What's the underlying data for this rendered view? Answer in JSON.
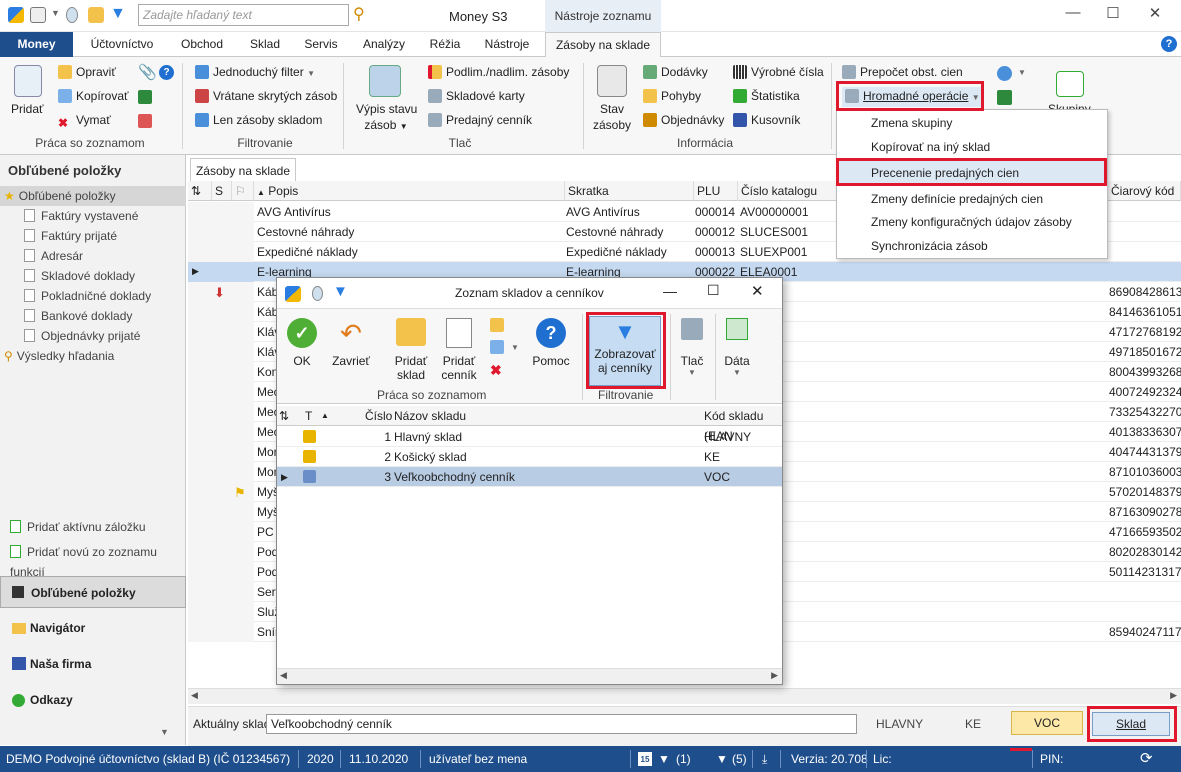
{
  "title_bar": {
    "app_title": "Money S3",
    "context_tab": "Nástroje zoznamu",
    "search_placeholder": "Zadajte hľadaný text"
  },
  "menu": {
    "items": [
      "Money",
      "Účtovníctvo",
      "Obchod",
      "Sklad",
      "Servis",
      "Analýzy",
      "Réžia",
      "Nástroje",
      "Zásoby na sklade"
    ],
    "active": "Zásoby na sklade"
  },
  "ribbon": {
    "praca": {
      "pridat": "Pridať",
      "opravit": "Opraviť",
      "kopirovat": "Kopírovať",
      "vymazat": "Vymať",
      "group": "Práca so zoznamom"
    },
    "filtrovanie": {
      "jednoduchy": "Jednoduchý filter",
      "vratane": "Vrátane skrytých zásob",
      "len": "Len zásoby skladom",
      "group": "Filtrovanie"
    },
    "tlac": {
      "vypis1": "Výpis stavu",
      "vypis2": "zásob",
      "podlim": "Podlim./nadlim. zásoby",
      "karty": "Skladové karty",
      "cennik": "Predajný cenník",
      "group": "Tlač"
    },
    "informacie": {
      "stav1": "Stav",
      "stav2": "zásoby",
      "dodavky": "Dodávky",
      "pohyby": "Pohyby",
      "objednavky": "Objednávky",
      "vyrobne": "Výrobné čísla",
      "statistika": "Štatistika",
      "kusovnik": "Kusovník",
      "group": "Informácia"
    },
    "extra": {
      "prepocet": "Prepočet obst. cien",
      "hromadne": "Hromadné operácie",
      "skupiny": "Skupiny"
    }
  },
  "dropdown": {
    "items": [
      "Zmena skupiny",
      "Kopírovať na iný sklad",
      "Precenenie predajných cien",
      "Zmeny definície predajných cien",
      "Zmeny konfiguračných údajov zásoby",
      "Synchronizácia zásob"
    ],
    "highlighted": "Precenenie predajných cien"
  },
  "sidebar": {
    "title": "Obľúbené položky",
    "root": "Obľúbené položky",
    "items": [
      "Faktúry vystavené",
      "Faktúry prijaté",
      "Adresár",
      "Skladové doklady",
      "Pokladničné doklady",
      "Bankové doklady",
      "Objednávky prijaté"
    ],
    "search_results": "Výsledky hľadania",
    "add_tab": "Pridať aktívnu záložku",
    "add_new": "Pridať novú zo zoznamu funkcií",
    "buttons": [
      "Obľúbené položky",
      "Navigátor",
      "Naša firma",
      "Odkazy"
    ]
  },
  "doc_tab": "Zásoby na sklade",
  "grid": {
    "headers": {
      "s": "S",
      "popis": "Popis",
      "skratka": "Skratka",
      "plu": "PLU",
      "katalog": "Číslo katalogu",
      "ciarovy": "Čiarový kód"
    },
    "rows": [
      {
        "popis": "AVG Antivírus",
        "skratka": "AVG Antivírus",
        "plu": "000014",
        "katalog": "AV00000001",
        "ciarovy": ""
      },
      {
        "popis": "Cestovné náhrady",
        "skratka": "Cestovné náhrady",
        "plu": "000012",
        "katalog": "SLUCES001",
        "ciarovy": ""
      },
      {
        "popis": "Expedičné náklady",
        "skratka": "Expedičné náklady",
        "plu": "000013",
        "katalog": "SLUEXP001",
        "ciarovy": ""
      },
      {
        "popis": "E-learning",
        "skratka": "E-learning",
        "plu": "000022",
        "katalog": "ELEA0001",
        "ciarovy": ""
      },
      {
        "popis": "Kábe",
        "skratka": "",
        "plu": "",
        "katalog": "001",
        "ciarovy": "86908428613"
      },
      {
        "popis": "Kábe",
        "skratka": "",
        "plu": "",
        "katalog": "001",
        "ciarovy": "84146361051"
      },
      {
        "popis": "Kláv",
        "skratka": "",
        "plu": "",
        "katalog": "001",
        "ciarovy": "47172768192"
      },
      {
        "popis": "Kláv",
        "skratka": "",
        "plu": "",
        "katalog": "001",
        "ciarovy": "49718501672"
      },
      {
        "popis": "Kon",
        "skratka": "",
        "plu": "",
        "katalog": "",
        "ciarovy": "80043993268"
      },
      {
        "popis": "Mec",
        "skratka": "",
        "plu": "",
        "katalog": "001",
        "ciarovy": "40072492324"
      },
      {
        "popis": "Mec",
        "skratka": "",
        "plu": "",
        "katalog": "001",
        "ciarovy": "73325432270"
      },
      {
        "popis": "Mec",
        "skratka": "",
        "plu": "",
        "katalog": "001",
        "ciarovy": "40138336307"
      },
      {
        "popis": "Mon",
        "skratka": "",
        "plu": "",
        "katalog": "001",
        "ciarovy": "40474431379"
      },
      {
        "popis": "Mon",
        "skratka": "",
        "plu": "",
        "katalog": "001",
        "ciarovy": "87101036003"
      },
      {
        "popis": "Myš",
        "skratka": "",
        "plu": "",
        "katalog": "001",
        "ciarovy": "57020148379"
      },
      {
        "popis": "Myš",
        "skratka": "",
        "plu": "",
        "katalog": "001",
        "ciarovy": "87163090278"
      },
      {
        "popis": "PC z",
        "skratka": "",
        "plu": "",
        "katalog": "001",
        "ciarovy": "47166593502"
      },
      {
        "popis": "Podl",
        "skratka": "",
        "plu": "",
        "katalog": "001",
        "ciarovy": "80202830142"
      },
      {
        "popis": "Podl",
        "skratka": "",
        "plu": "",
        "katalog": "001",
        "ciarovy": "50114231317"
      },
      {
        "popis": "Serv",
        "skratka": "",
        "plu": "",
        "katalog": "001",
        "ciarovy": ""
      },
      {
        "popis": "Služ",
        "skratka": "",
        "plu": "",
        "katalog": "001",
        "ciarovy": ""
      },
      {
        "popis": "Snín",
        "skratka": "",
        "plu": "",
        "katalog": "001",
        "ciarovy": "85940247117"
      }
    ]
  },
  "dialog": {
    "title": "Zoznam skladov a cenníkov",
    "buttons": {
      "ok": "OK",
      "zavriet": "Zavrieť",
      "pridat_sklad1": "Pridať",
      "pridat_sklad2": "sklad",
      "pridat_cennik1": "Pridať",
      "pridat_cennik2": "cenník",
      "pomoc": "Pomoc",
      "zobrazovat1": "Zobrazovať",
      "zobrazovat2": "aj cenníky",
      "tlac": "Tlač",
      "data": "Dáta"
    },
    "groups": {
      "praca": "Práca so zoznamom",
      "filtrovanie": "Filtrovanie"
    },
    "headers": {
      "t": "T",
      "cislo": "Číslo",
      "nazov": "Názov skladu",
      "kod": "Kód skladu (EAN"
    },
    "rows": [
      {
        "cislo": "1",
        "nazov": "Hlavný sklad",
        "kod": "HLAVNY"
      },
      {
        "cislo": "2",
        "nazov": "Košický sklad",
        "kod": "KE"
      },
      {
        "cislo": "3",
        "nazov": "Veľkoobchodný cenník",
        "kod": "VOC"
      }
    ]
  },
  "bottom": {
    "label": "Aktuálny sklad",
    "value": "Veľkoobchodný cenník",
    "hlavny": "HLAVNY",
    "ke": "KE",
    "voc": "VOC",
    "sklad_btn": "Sklad"
  },
  "status": {
    "company": "DEMO Podvojné účtovníctvo (sklad B) (IČ 01234567)",
    "year": "2020",
    "date": "11.10.2020",
    "user": "užívateľ bez mena",
    "cal": "15",
    "down1": "(1)",
    "down5": "(5)",
    "version": "Verzia: 20.708",
    "lic": "Lic:",
    "pin": "PIN:"
  },
  "colors": {
    "accent": "#1e4e8c",
    "highlight_red": "#e0182d",
    "selection": "#c5d9f1",
    "voc": "#fde8a8"
  }
}
